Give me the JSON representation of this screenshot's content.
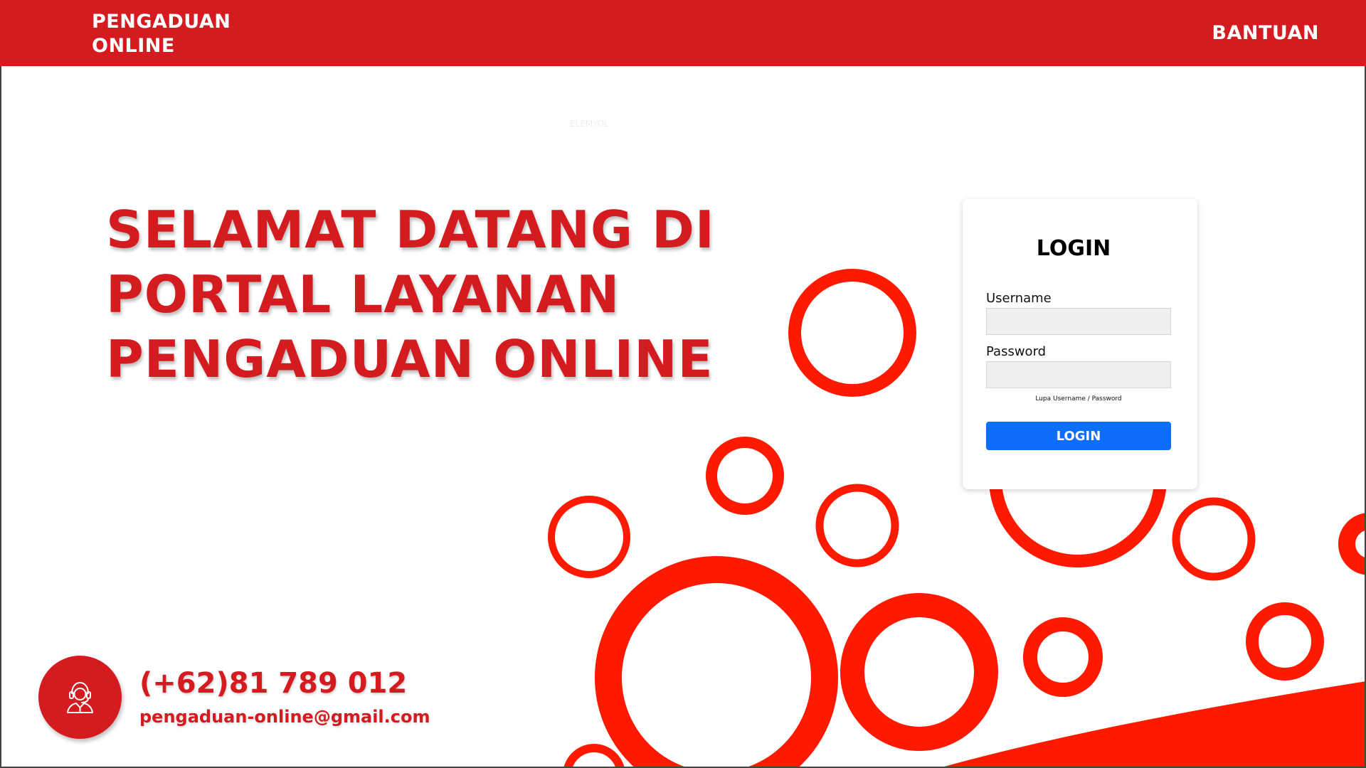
{
  "header": {
    "brand": "PENGADUAN ONLINE",
    "help_link": "BANTUAN"
  },
  "hero": {
    "title": "SELAMAT DATANG DI PORTAL LAYANAN PENGADUAN ONLINE",
    "faint_text": "ELEMYOL"
  },
  "login": {
    "title": "LOGIN",
    "username_label": "Username",
    "username_value": "",
    "password_label": "Password",
    "password_value": "",
    "forgot_link": "Lupa Username / Password",
    "submit_label": "LOGIN"
  },
  "contact": {
    "icon": "customer-service-icon",
    "phone": "(+62)81 789 012",
    "email": "pengaduan-online@gmail.com"
  },
  "colors": {
    "brand_red": "#d41b1f",
    "circle_red": "#fe1a00",
    "button_blue": "#0d6efd"
  }
}
